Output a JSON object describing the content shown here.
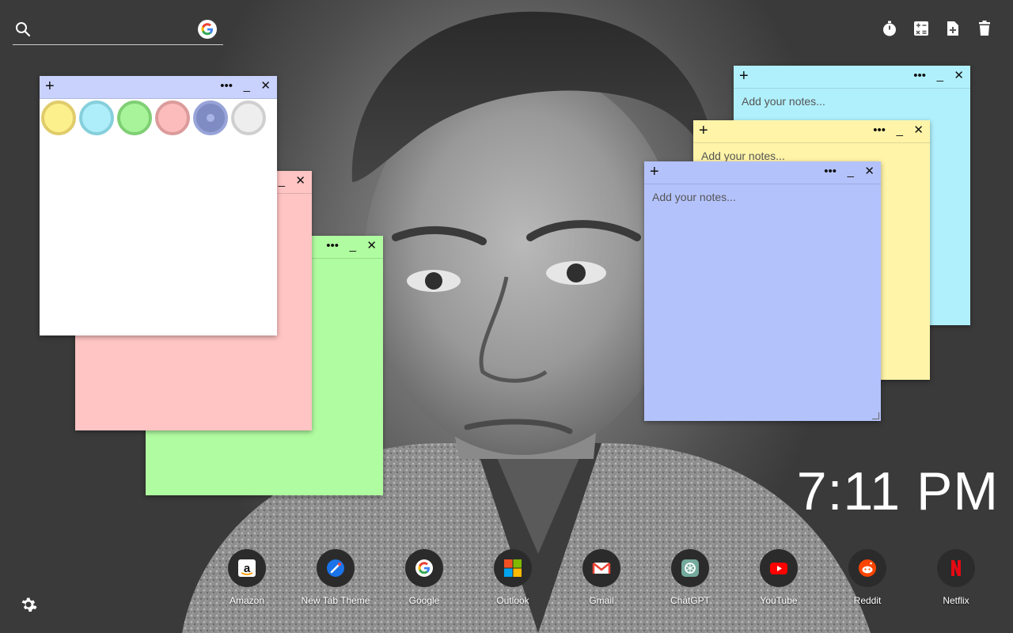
{
  "search": {
    "placeholder": "",
    "icon": "search-icon",
    "engine_icon": "google-icon"
  },
  "toolbar": {
    "icons": [
      "timer-icon",
      "calculator-icon",
      "add-note-icon",
      "trash-icon"
    ]
  },
  "notes": {
    "placeholder": "Add your notes...",
    "controls": {
      "add": "+",
      "menu": "•••",
      "minimize": "_",
      "close": "✕"
    },
    "colors": {
      "white": "#ffffff",
      "pink": "#ffc4c4",
      "green": "#b0fca0",
      "cyan": "#b0f0fc",
      "yellow": "#fff4a8",
      "blue": "#b4c2fc",
      "bar_white": "#c8d2fc",
      "bar_pink": "#ffc4c4",
      "bar_green": "#b0fca0"
    },
    "palette": [
      {
        "name": "yellow",
        "fill": "#fcf08c",
        "ring": "#e0cc6a"
      },
      {
        "name": "cyan",
        "fill": "#aeeefa",
        "ring": "#86cfdc"
      },
      {
        "name": "green",
        "fill": "#a8f49a",
        "ring": "#7fcf74"
      },
      {
        "name": "pink",
        "fill": "#fcbcbc",
        "ring": "#dc9b9b"
      },
      {
        "name": "blue",
        "fill": "#7f8cc4",
        "ring": "#98a4d8"
      },
      {
        "name": "white",
        "fill": "#eeeeee",
        "ring": "#cfcfcf"
      }
    ]
  },
  "clock": {
    "time": "7:11 PM"
  },
  "shortcuts": [
    {
      "label": "Amazon",
      "icon": "amazon-icon"
    },
    {
      "label": "New Tab Theme",
      "icon": "new-tab-theme-icon"
    },
    {
      "label": "Google",
      "icon": "google-icon"
    },
    {
      "label": "Outlook",
      "icon": "outlook-icon"
    },
    {
      "label": "Gmail",
      "icon": "gmail-icon"
    },
    {
      "label": "ChatGPT",
      "icon": "chatgpt-icon"
    },
    {
      "label": "YouTube",
      "icon": "youtube-icon"
    },
    {
      "label": "Reddit",
      "icon": "reddit-icon"
    },
    {
      "label": "Netflix",
      "icon": "netflix-icon"
    }
  ],
  "settings": {
    "icon": "gear-icon"
  }
}
